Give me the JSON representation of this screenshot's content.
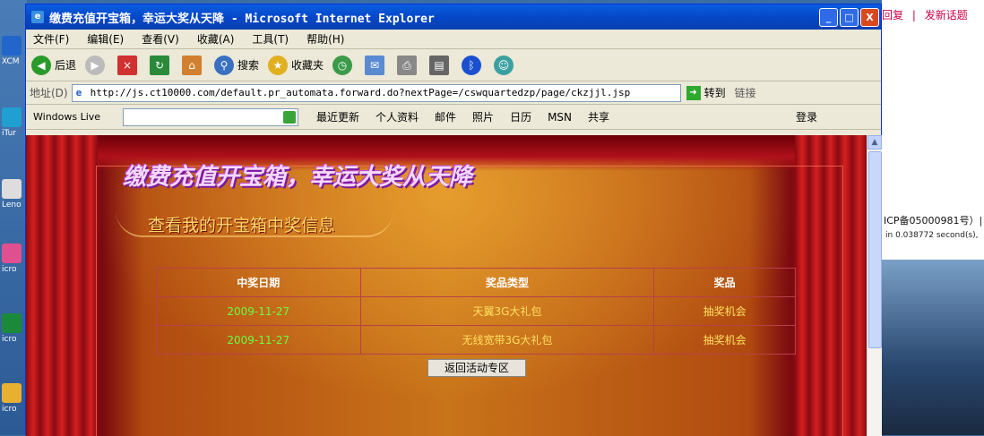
{
  "desktop": {
    "icons": [
      "XCM",
      "iTur",
      "Leno",
      "icro",
      "icro",
      "icro"
    ]
  },
  "background_window": {
    "links": [
      "回复",
      "|",
      "发新话题"
    ],
    "icp": "ICP备05000981号）|",
    "timing": "in 0.038772 second(s),"
  },
  "window": {
    "title": "缴费充值开宝箱，幸运大奖从天降 - Microsoft Internet Explorer",
    "minimize": "_",
    "maximize": "□",
    "close": "X"
  },
  "menu": [
    "文件(F)",
    "编辑(E)",
    "查看(V)",
    "收藏(A)",
    "工具(T)",
    "帮助(H)"
  ],
  "toolbar": {
    "back": "后退",
    "search": "搜索",
    "favorites": "收藏夹"
  },
  "address": {
    "label": "地址(D)",
    "url": "http://js.ct10000.com/default.pr_automata.forward.do?nextPage=/cswquartedzp/page/ckzjjl.jsp",
    "go": "转到",
    "links": "链接"
  },
  "windows_live": {
    "logo": "Windows Live",
    "links": [
      "最近更新",
      "个人资料",
      "邮件",
      "照片",
      "日历",
      "MSN",
      "共享"
    ],
    "signin": "登录"
  },
  "page": {
    "headline": "缴费充值开宝箱，幸运大奖从天降",
    "subhead": "查看我的开宝箱中奖信息",
    "table": {
      "headers": [
        "中奖日期",
        "奖品类型",
        "奖品"
      ],
      "rows": [
        [
          "2009-11-27",
          "天翼3G大礼包",
          "抽奖机会"
        ],
        [
          "2009-11-27",
          "无线宽带3G大礼包",
          "抽奖机会"
        ]
      ]
    },
    "back_button": "返回活动专区"
  }
}
